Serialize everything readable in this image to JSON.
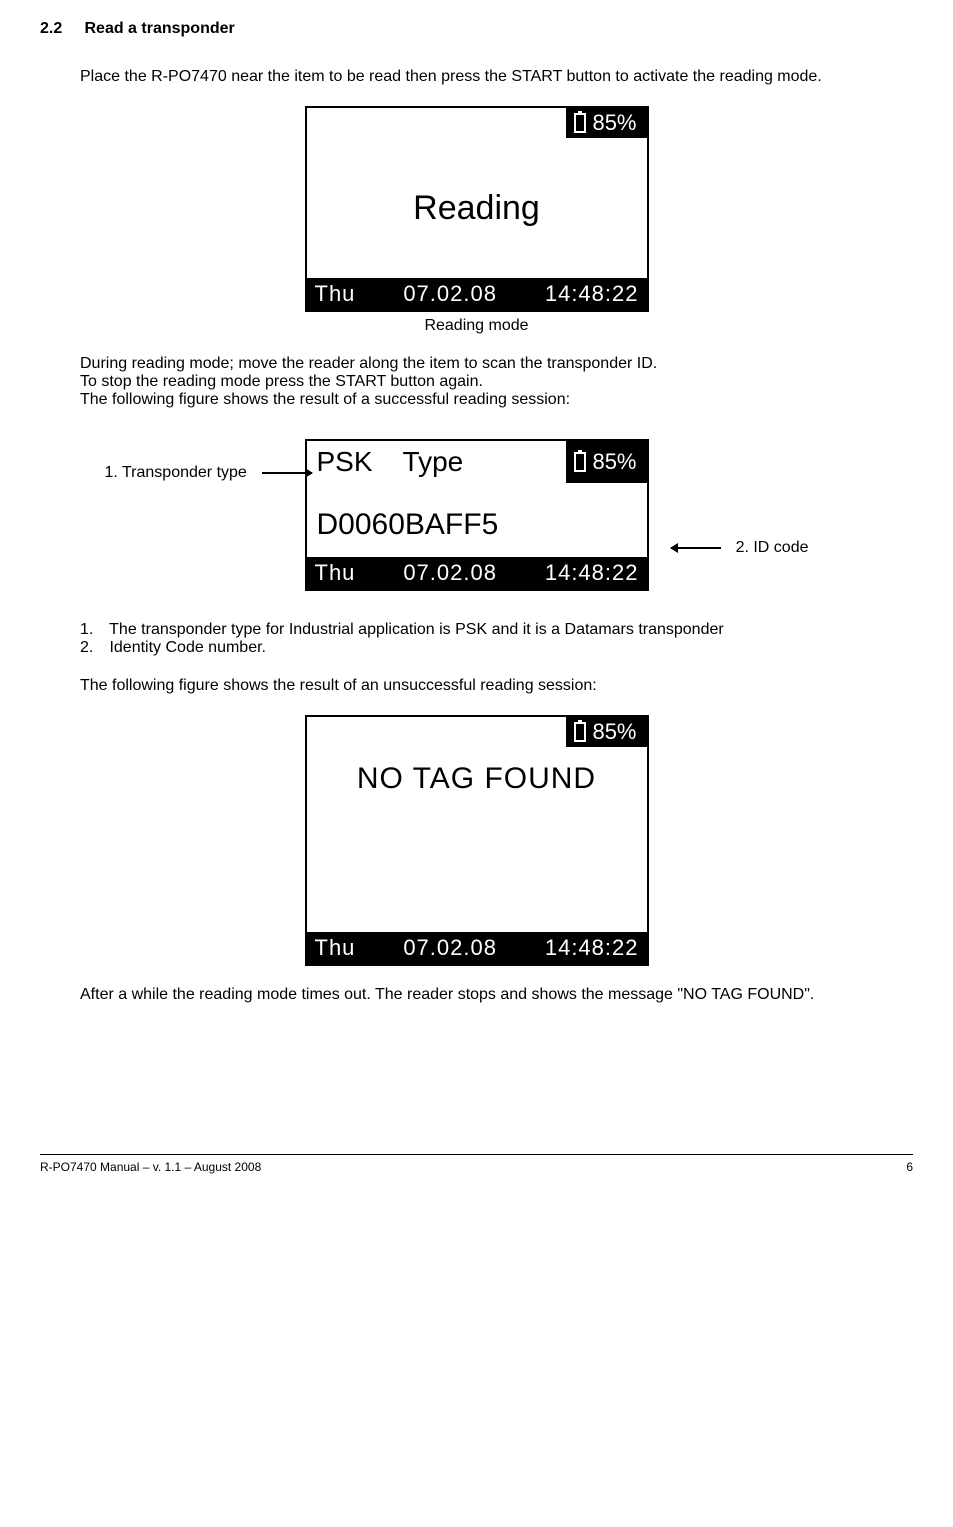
{
  "section": {
    "number": "2.2",
    "title": "Read a transponder"
  },
  "para1": "Place the R-PO7470 near the item to be read then press the START button to activate the reading mode.",
  "screen1": {
    "battery": "85%",
    "main_text": "Reading",
    "day": "Thu",
    "date": "07.02.08",
    "time": "14:48:22",
    "caption": "Reading mode"
  },
  "para2_l1": "During reading mode; move the reader along the item to scan the transponder ID.",
  "para2_l2": "To stop the reading mode press the START button again.",
  "para2_l3": "The following figure shows the result of a successful reading session:",
  "annotation_left": "1. Transponder type",
  "annotation_right": "2. ID code",
  "screen2": {
    "battery": "85%",
    "t1": "PSK",
    "t2": "Type",
    "id": "D0060BAFF5",
    "day": "Thu",
    "date": "07.02.08",
    "time": "14:48:22"
  },
  "list": {
    "n1": "1.",
    "i1": "The transponder type for Industrial application is PSK and it is a Datamars transponder",
    "n2": "2.",
    "i2": "Identity Code number."
  },
  "para3": "The following figure shows the result of an unsuccessful reading session:",
  "screen3": {
    "battery": "85%",
    "main_text": "NO TAG FOUND",
    "day": "Thu",
    "date": "07.02.08",
    "time": "14:48:22"
  },
  "para4": "After a while the reading mode times out.  The reader stops and shows the message \"NO TAG FOUND\".",
  "footer": {
    "left": "R-PO7470 Manual – v. 1.1 – August 2008",
    "right": "6"
  }
}
